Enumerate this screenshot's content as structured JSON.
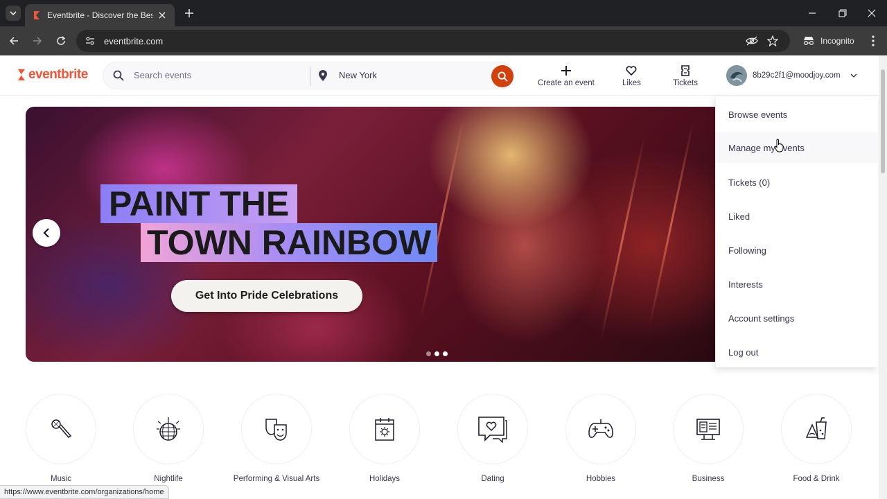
{
  "browser": {
    "tab_title": "Eventbrite - Discover the Best L",
    "url": "eventbrite.com",
    "incognito_label": "Incognito",
    "status_url": "https://www.eventbrite.com/organizations/home"
  },
  "header": {
    "logo_text": "eventbrite",
    "search_placeholder": "Search events",
    "location": "New York",
    "nav": [
      {
        "label": "Create an event",
        "icon": "plus-icon"
      },
      {
        "label": "Likes",
        "icon": "heart-icon"
      },
      {
        "label": "Tickets",
        "icon": "ticket-icon"
      }
    ],
    "user_email": "8b29c2f1@moodjoy.com"
  },
  "hero": {
    "line1": "PAINT THE",
    "line2": "TOWN RAINBOW",
    "cta": "Get Into Pride Celebrations",
    "slide_count": 3,
    "active_slide": 2
  },
  "dropdown": {
    "items": [
      "Browse events",
      "Manage my events",
      "Tickets (0)",
      "Liked",
      "Following",
      "Interests",
      "Account settings",
      "Log out"
    ],
    "hovered_index": 1
  },
  "categories": [
    {
      "label": "Music",
      "icon": "microphone-icon"
    },
    {
      "label": "Nightlife",
      "icon": "disco-ball-icon"
    },
    {
      "label": "Performing & Visual Arts",
      "icon": "theater-masks-icon"
    },
    {
      "label": "Holidays",
      "icon": "calendar-icon"
    },
    {
      "label": "Dating",
      "icon": "chat-heart-icon"
    },
    {
      "label": "Hobbies",
      "icon": "gamepad-icon"
    },
    {
      "label": "Business",
      "icon": "presentation-icon"
    },
    {
      "label": "Food & Drink",
      "icon": "food-drink-icon"
    }
  ],
  "colors": {
    "brand": "#f05537",
    "search_button": "#d1410c",
    "text": "#39364f"
  }
}
